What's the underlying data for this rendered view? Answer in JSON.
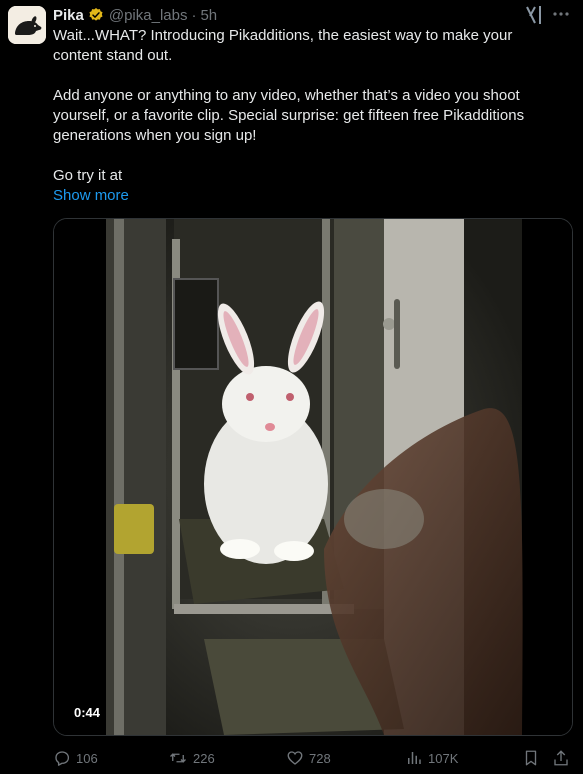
{
  "tweet": {
    "author_name": "Pika",
    "handle": "@pika_labs",
    "separator": "·",
    "time": "5h",
    "body_lines": [
      "Wait...WHAT? Introducing Pikadditions, the easiest way to make your",
      "content stand out.",
      "",
      "Add anyone or anything to any video, whether that’s a video you shoot",
      "yourself, or a favorite clip.  Special surprise: get fifteen free Pikadditions",
      "generations when you sign up!",
      "",
      "Go try it at"
    ],
    "show_more": "Show more"
  },
  "media": {
    "duration": "0:44"
  },
  "actions": {
    "replies": "106",
    "reposts": "226",
    "likes": "728",
    "views": "107K"
  },
  "colors": {
    "background": "#000000",
    "text": "#e7e9ea",
    "muted": "#71767b",
    "link": "#1d9bf0",
    "verified": "#e2b719"
  },
  "icons": [
    "verified-badge-icon",
    "grok-icon",
    "more-options-icon",
    "reply-icon",
    "repost-icon",
    "like-icon",
    "views-icon",
    "bookmark-icon",
    "share-icon"
  ]
}
